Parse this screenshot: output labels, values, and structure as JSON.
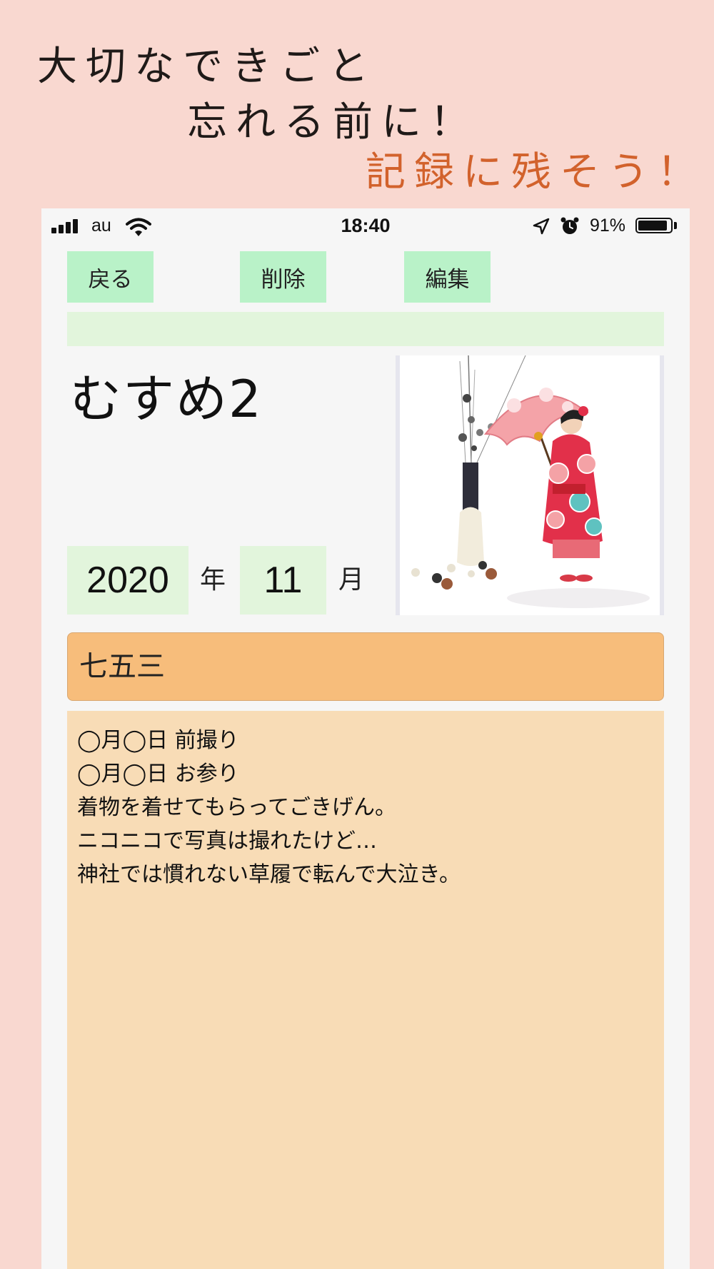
{
  "promo": {
    "line1": "大切なできごと",
    "line2": "忘れる前に！",
    "line3": "記録に残そう！"
  },
  "status_bar": {
    "carrier": "au",
    "time": "18:40",
    "battery_percent": "91%",
    "battery_level": 0.91,
    "icons": [
      "signal-icon",
      "wifi-icon",
      "location-icon",
      "alarm-icon",
      "battery-icon"
    ]
  },
  "toolbar": {
    "back_label": "戻る",
    "delete_label": "削除",
    "edit_label": "編集"
  },
  "record": {
    "name": "むすめ2",
    "year": "2020",
    "year_unit": "年",
    "month": "11",
    "month_unit": "月",
    "event_title": "七五三",
    "memo_lines": [
      "◯月◯日 前撮り",
      "◯月◯日 お参り",
      "着物を着せてもらってごきげん。",
      "ニコニコで写真は撮れたけど…",
      "神社では慣れない草履で転んで大泣き。"
    ]
  },
  "colors": {
    "page_background": "#f9d8d0",
    "button_green": "#b9f2c8",
    "field_green": "#e2f5dc",
    "event_orange": "#f7bd7b",
    "memo_peach": "#f8dcb6",
    "promo_accent": "#d2622c"
  }
}
